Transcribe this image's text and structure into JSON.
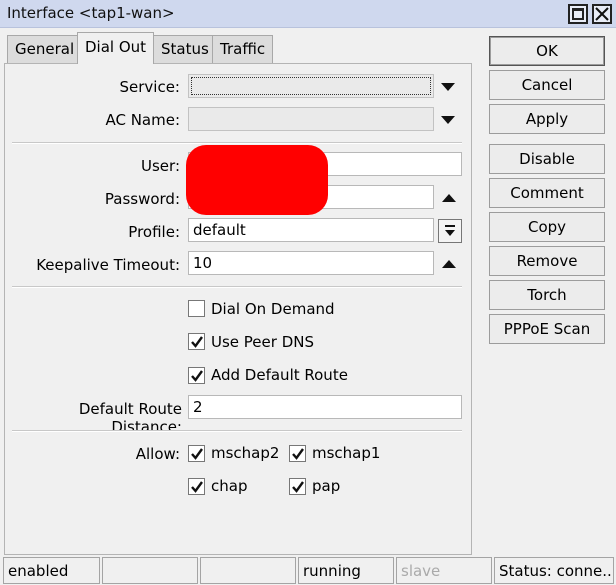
{
  "window": {
    "title": "Interface <tap1-wan>"
  },
  "tabs": [
    {
      "label": "General"
    },
    {
      "label": "Dial Out",
      "active": true
    },
    {
      "label": "Status"
    },
    {
      "label": "Traffic"
    }
  ],
  "form": {
    "service": {
      "label": "Service:",
      "value": ""
    },
    "ac_name": {
      "label": "AC Name:",
      "value": ""
    },
    "user": {
      "label": "User:",
      "value": ""
    },
    "password": {
      "label": "Password:",
      "value": ""
    },
    "profile": {
      "label": "Profile:",
      "value": "default"
    },
    "keepalive": {
      "label": "Keepalive Timeout:",
      "value": "10"
    },
    "dial_on_demand": {
      "label": "Dial On Demand",
      "checked": false
    },
    "use_peer_dns": {
      "label": "Use Peer DNS",
      "checked": true
    },
    "add_default_route": {
      "label": "Add Default Route",
      "checked": true
    },
    "default_route_distance": {
      "label": "Default Route Distance:",
      "value": "2"
    },
    "allow": {
      "label": "Allow:",
      "mschap2": {
        "label": "mschap2",
        "checked": true
      },
      "mschap1": {
        "label": "mschap1",
        "checked": true
      },
      "chap": {
        "label": "chap",
        "checked": true
      },
      "pap": {
        "label": "pap",
        "checked": true
      }
    }
  },
  "buttons": {
    "ok": "OK",
    "cancel": "Cancel",
    "apply": "Apply",
    "disable": "Disable",
    "comment": "Comment",
    "copy": "Copy",
    "remove": "Remove",
    "torch": "Torch",
    "pppoe_scan": "PPPoE Scan"
  },
  "statusbar": {
    "enabled": "enabled",
    "running": "running",
    "slave": "slave",
    "status": "Status: conne..."
  }
}
